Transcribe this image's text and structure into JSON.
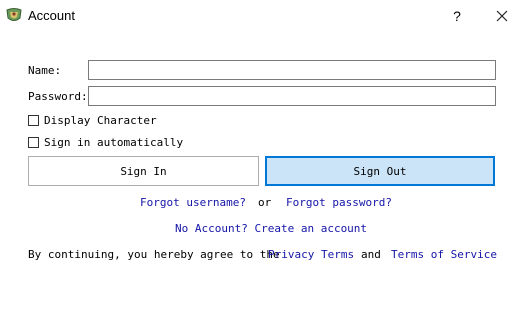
{
  "window": {
    "title": "Account",
    "help_label": "?",
    "icons": {
      "app": "app-logo-icon",
      "close": "close-icon"
    }
  },
  "form": {
    "name_label": "Name:",
    "name_value": "",
    "password_label": "Password:",
    "password_value": "",
    "display_character_label": "Display Character",
    "display_character_checked": false,
    "sign_in_auto_label": "Sign in automatically",
    "sign_in_auto_checked": false
  },
  "buttons": {
    "sign_in": "Sign In",
    "sign_out": "Sign Out"
  },
  "links": {
    "forgot_username": "Forgot username?",
    "or": "or",
    "forgot_password": "Forgot password?",
    "create_account": "No Account? Create an account"
  },
  "footer": {
    "agree_text": "By continuing, you hereby agree to the",
    "privacy_terms": "Privacy Terms",
    "and": "and",
    "terms_of_service": "Terms of Service"
  },
  "colors": {
    "link": "#1515a8",
    "focus_border": "#0078d7",
    "focus_fill": "#cce4f7"
  }
}
